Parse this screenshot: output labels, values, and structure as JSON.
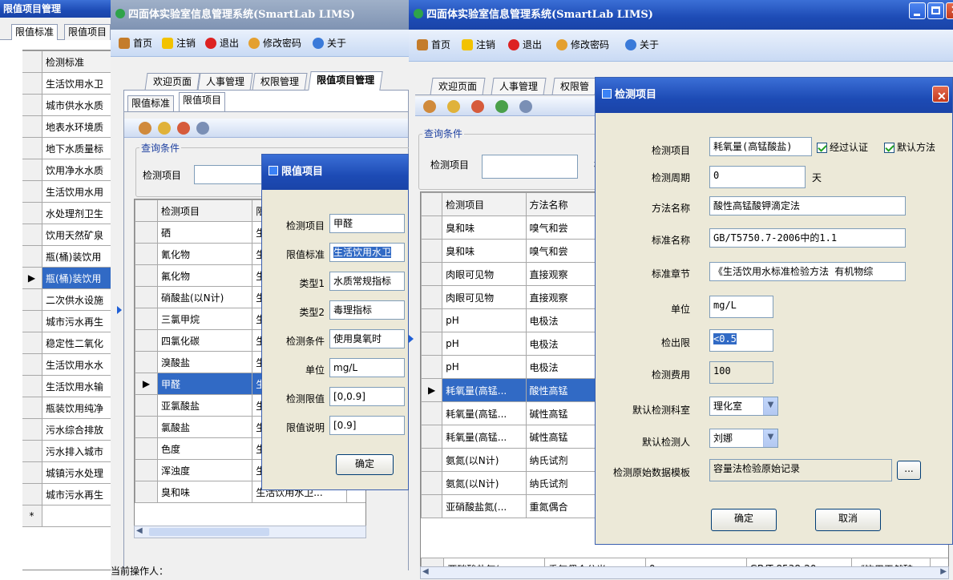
{
  "win1": {
    "title": "限值项目管理",
    "tabs": [
      "限值标准",
      "限值项目"
    ],
    "column": "检测标准",
    "rows": [
      "生活饮用水卫",
      "城市供水水质",
      "地表水环境质",
      "地下水质量标",
      "饮用净水水质",
      "生活饮用水用",
      "水处理剂卫生",
      "饮用天然矿泉",
      "瓶(桶)装饮用",
      "瓶(桶)装饮用",
      "二次供水设施",
      "城市污水再生",
      "稳定性二氧化",
      "生活饮用水水",
      "生活饮用水输",
      "瓶装饮用纯净",
      "污水综合排放",
      "污水排入城市",
      "城镇污水处理",
      "城市污水再生"
    ],
    "selected_row": 9,
    "new_row_marker": "*"
  },
  "win2": {
    "title": "四面体实验室信息管理系统(SmartLab LIMS)",
    "toolbar": [
      "首页",
      "注销",
      "退出",
      "修改密码",
      "关于"
    ],
    "tabs": [
      "欢迎页面",
      "人事管理",
      "权限管理",
      "限值项目管理"
    ],
    "subtabs": [
      "限值标准",
      "限值项目"
    ],
    "group_label": "查询条件",
    "query_label": "检测项目",
    "columns": [
      "检测项目",
      "限"
    ],
    "rows": [
      [
        "硒",
        "生"
      ],
      [
        "氰化物",
        "生"
      ],
      [
        "氟化物",
        "生"
      ],
      [
        "硝酸盐(以N计)",
        "生"
      ],
      [
        "三氯甲烷",
        "生"
      ],
      [
        "四氯化碳",
        "生"
      ],
      [
        "溴酸盐",
        "生"
      ],
      [
        "甲醛",
        "生"
      ],
      [
        "亚氯酸盐",
        "生"
      ],
      [
        "氯酸盐",
        "生"
      ],
      [
        "色度",
        "生"
      ],
      [
        "浑浊度",
        "生"
      ],
      [
        "臭和味",
        "生活饮用水卫..."
      ]
    ],
    "selected_row": 7,
    "status_label": "当前操作人：",
    "dialog": {
      "title": "限值项目",
      "fields": [
        {
          "label": "检测项目",
          "value": "甲醛"
        },
        {
          "label": "限值标准",
          "value": "生活饮用水卫"
        },
        {
          "label": "类型1",
          "value": "水质常规指标"
        },
        {
          "label": "类型2",
          "value": "毒理指标"
        },
        {
          "label": "检测条件",
          "value": "使用臭氧时"
        },
        {
          "label": "单位",
          "value": "mg/L"
        },
        {
          "label": "检测限值",
          "value": "[0,0.9]"
        },
        {
          "label": "限值说明",
          "value": "[0.9]"
        }
      ],
      "ok": "确定"
    }
  },
  "win3": {
    "title": "四面体实验室信息管理系统(SmartLab LIMS)",
    "toolbar": [
      "首页",
      "注销",
      "退出",
      "修改密码",
      "关于"
    ],
    "tabs": [
      "欢迎页面",
      "人事管理",
      "权限管"
    ],
    "group_label": "查询条件",
    "query_label": "检测项目",
    "query_label2": "检",
    "columns": [
      "检测项目",
      "方法名称"
    ],
    "rows": [
      [
        "臭和味",
        "嗅气和尝"
      ],
      [
        "臭和味",
        "嗅气和尝"
      ],
      [
        "肉眼可见物",
        "直接观察"
      ],
      [
        "肉眼可见物",
        "直接观察"
      ],
      [
        "pH",
        "电极法"
      ],
      [
        "pH",
        "电极法"
      ],
      [
        "pH",
        "电极法"
      ],
      [
        "耗氧量(高锰...",
        "酸性高锰"
      ],
      [
        "耗氧量(高锰...",
        "碱性高锰"
      ],
      [
        "耗氧量(高锰...",
        "碱性高锰"
      ],
      [
        "氨氮(以N计)",
        "纳氏试剂"
      ],
      [
        "氨氮(以N计)",
        "纳氏试剂"
      ],
      [
        "亚硝酸盐氮(...",
        "重氮偶合"
      ]
    ],
    "partial_row": [
      "亚硝酸盐氮(",
      "重氮偶合分光",
      "0",
      "GB/T 8538-20",
      "《饮用天然矿",
      "mg/"
    ],
    "selected_row": 7,
    "dialog": {
      "title": "检测项目",
      "item_label": "检测项目",
      "item_value": "耗氧量(高锰酸盐)",
      "check1": "经过认证",
      "check2": "默认方法",
      "cycle_label": "检测周期",
      "cycle_value": "0",
      "cycle_unit": "天",
      "method_label": "方法名称",
      "method_value": "酸性高锰酸钾滴定法",
      "std_label": "标准名称",
      "std_value": "GB/T5750.7-2006中的1.1",
      "chapter_label": "标准章节",
      "chapter_value": "《生活饮用水标准检验方法  有机物综",
      "unit_label": "单位",
      "unit_value": "mg/L",
      "limit_label": "检出限",
      "limit_value": "<0.5",
      "fee_label": "检测费用",
      "fee_value": "100",
      "dept_label": "默认检测科室",
      "dept_value": "理化室",
      "person_label": "默认检测人",
      "person_value": "刘娜",
      "tpl_label": "检测原始数据模板",
      "tpl_value": "容量法检验原始记录",
      "browse": "...",
      "ok": "确定",
      "cancel": "取消"
    }
  },
  "colors": {
    "title_blue": "#1d4bb5",
    "select_blue": "#316ac5",
    "close_red": "#d2452b"
  }
}
